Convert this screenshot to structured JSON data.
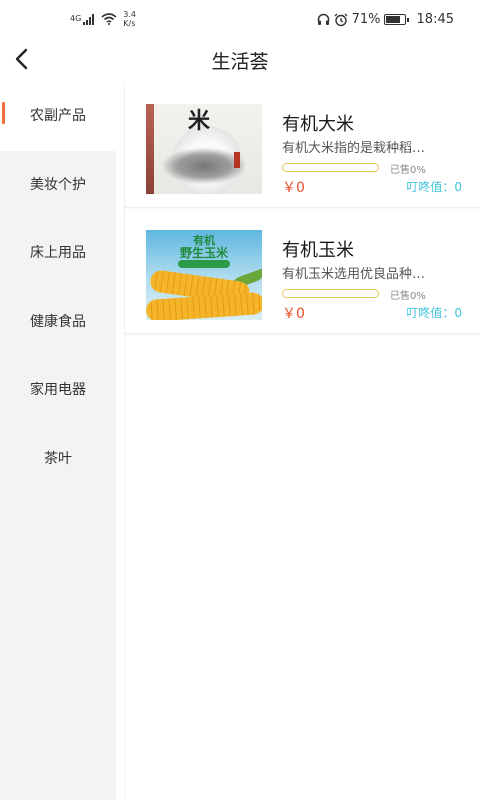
{
  "status_bar": {
    "network": "4G",
    "speed_value": "3.4",
    "speed_unit": "K/s",
    "battery": "71%",
    "time": "18:45"
  },
  "header": {
    "title": "生活荟",
    "back_icon": "chevron-left-icon"
  },
  "sidebar": {
    "active_index": 0,
    "items": [
      {
        "label": "农副产品"
      },
      {
        "label": "美妆个护"
      },
      {
        "label": "床上用品"
      },
      {
        "label": "健康食品"
      },
      {
        "label": "家用电器"
      },
      {
        "label": "茶叶"
      }
    ]
  },
  "products": [
    {
      "name": "有机大米",
      "desc": "有机大米指的是栽种稻…",
      "sold": "已售0%",
      "sold_fraction": 0,
      "price": "￥0",
      "dongdong": "叮咚值：0",
      "image_text": "米"
    },
    {
      "name": "有机玉米",
      "desc": "有机玉米选用优良品种…",
      "sold": "已售0%",
      "sold_fraction": 0,
      "price": "￥0",
      "dongdong": "叮咚值：0",
      "image_title": "有机",
      "image_subtitle": "野生玉米"
    }
  ],
  "colors": {
    "accent": "#f0703a",
    "price": "#e8502b",
    "dongdong": "#3ec3dc",
    "progress": "#e6c65a",
    "sidebar_bg": "#f3f2f5"
  }
}
